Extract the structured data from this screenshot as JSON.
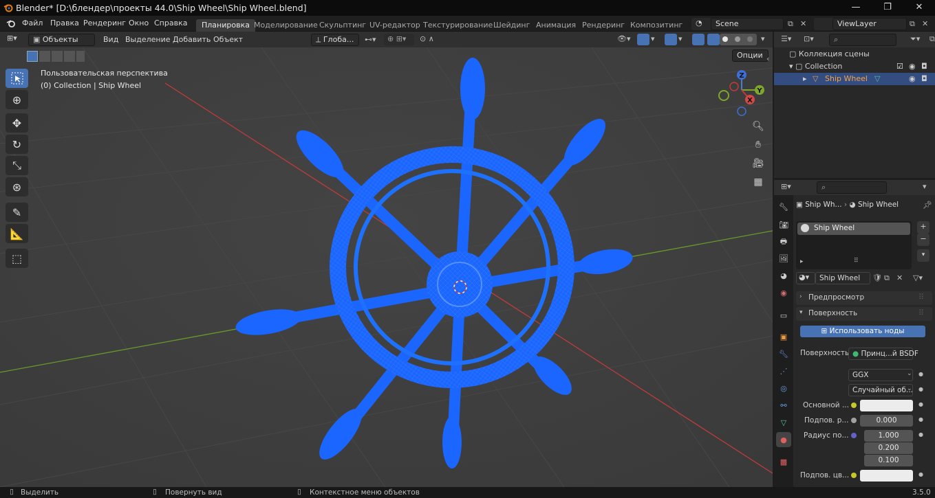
{
  "window": {
    "title": "Blender* [D:\\блендер\\проекты 44.0\\Ship Wheel\\Ship Wheel.blend]",
    "minimize": "—",
    "maximize": "❐",
    "close": "✕"
  },
  "menu": [
    "Файл",
    "Правка",
    "Рендеринг",
    "Окно",
    "Справка"
  ],
  "workspaces": [
    "Планировка",
    "Моделирование",
    "Скульптинг",
    "UV-редактор",
    "Текстурирование",
    "Шейдинг",
    "Анимация",
    "Рендеринг",
    "Композитинг"
  ],
  "scene": {
    "name": "Scene",
    "view_layer": "ViewLayer"
  },
  "viewport_header": {
    "mode": "Объекты",
    "menus": [
      "Вид",
      "Выделение",
      "Добавить",
      "Объект"
    ],
    "transform_orientation": "Глоба...",
    "options": "Опции"
  },
  "viewport": {
    "perspective": "Пользовательская перспектива",
    "collection_info": "(0) Collection | Ship Wheel",
    "gizmo": {
      "z": "Z",
      "y": "Y",
      "x": "X"
    }
  },
  "outliner": {
    "scene_collection": "Коллекция сцены",
    "collection": "Collection",
    "object": "Ship Wheel"
  },
  "properties": {
    "breadcrumb": [
      "Ship Wh...",
      "Ship Wheel"
    ],
    "material_slot": "Ship Wheel",
    "material_name": "Ship Wheel",
    "panel_preview": "Предпросмотр",
    "panel_surface": "Поверхность",
    "use_nodes": "Использовать ноды",
    "surface_label": "Поверхность",
    "surface_value": "Принц...й BSDF",
    "distribution": "GGX",
    "subsurface_method": "Случайный об...",
    "base_color_label": "Основной ...",
    "subsurface_label": "Подпов. р...",
    "subsurface_value": "0.000",
    "radius_label": "Радиус по...",
    "radius_values": [
      "1.000",
      "0.200",
      "0.100"
    ],
    "subsurface_color_label": "Подпов. цв..."
  },
  "status": {
    "select": "Выделить",
    "rotate": "Повернуть вид",
    "context": "Контекстное меню объектов",
    "version": "3.5.0"
  },
  "colors": {
    "accent": "#4772b3",
    "wireframe": "#1a66ff",
    "x_axis": "#c13b3b",
    "y_axis": "#6a9a2a"
  }
}
